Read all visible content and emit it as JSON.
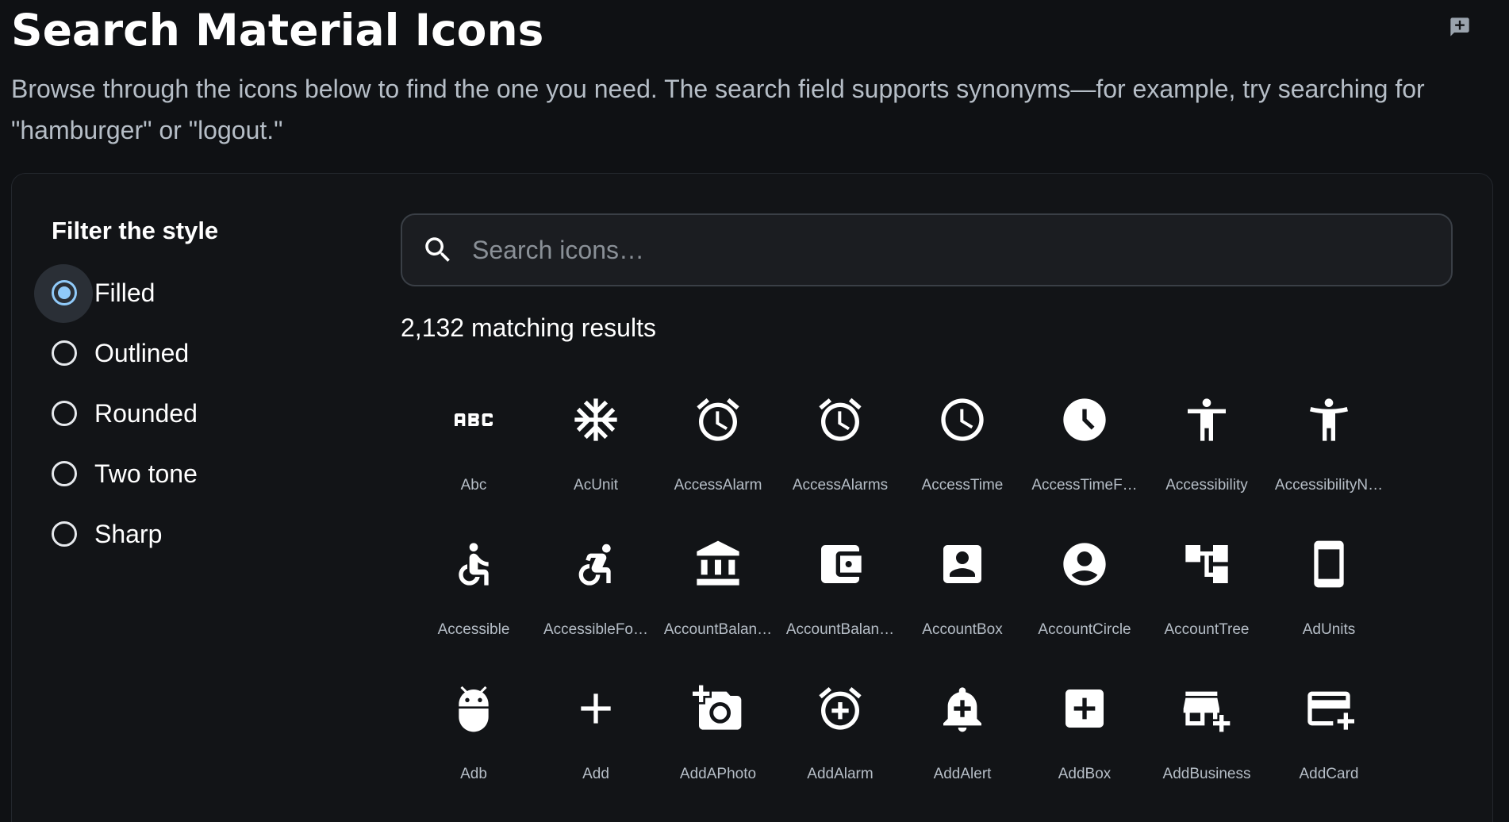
{
  "header": {
    "title": "Search Material Icons",
    "description": "Browse through the icons below to find the one you need. The search field supports synonyms—for example, try searching for \"hamburger\" or \"logout.\"",
    "feedback_icon": "add-comment-icon"
  },
  "filter": {
    "title": "Filter the style",
    "options": [
      {
        "label": "Filled",
        "selected": true
      },
      {
        "label": "Outlined",
        "selected": false
      },
      {
        "label": "Rounded",
        "selected": false
      },
      {
        "label": "Two tone",
        "selected": false
      },
      {
        "label": "Sharp",
        "selected": false
      }
    ]
  },
  "search": {
    "placeholder": "Search icons…",
    "value": ""
  },
  "results": {
    "count_label": "2,132 matching results"
  },
  "icons": [
    {
      "name": "Abc",
      "icon": "abc-icon"
    },
    {
      "name": "AcUnit",
      "icon": "ac-unit-icon"
    },
    {
      "name": "AccessAlarm",
      "icon": "access-alarm-icon"
    },
    {
      "name": "AccessAlarms",
      "icon": "access-alarms-icon"
    },
    {
      "name": "AccessTime",
      "icon": "access-time-icon"
    },
    {
      "name": "AccessTimeF…",
      "icon": "access-time-filled-icon"
    },
    {
      "name": "Accessibility",
      "icon": "accessibility-icon"
    },
    {
      "name": "AccessibilityN…",
      "icon": "accessibility-new-icon"
    },
    {
      "name": "Accessible",
      "icon": "accessible-icon"
    },
    {
      "name": "AccessibleFo…",
      "icon": "accessible-forward-icon"
    },
    {
      "name": "AccountBalan…",
      "icon": "account-balance-icon"
    },
    {
      "name": "AccountBalan…",
      "icon": "account-balance-wallet-icon"
    },
    {
      "name": "AccountBox",
      "icon": "account-box-icon"
    },
    {
      "name": "AccountCircle",
      "icon": "account-circle-icon"
    },
    {
      "name": "AccountTree",
      "icon": "account-tree-icon"
    },
    {
      "name": "AdUnits",
      "icon": "ad-units-icon"
    },
    {
      "name": "Adb",
      "icon": "adb-icon"
    },
    {
      "name": "Add",
      "icon": "add-icon"
    },
    {
      "name": "AddAPhoto",
      "icon": "add-a-photo-icon"
    },
    {
      "name": "AddAlarm",
      "icon": "add-alarm-icon"
    },
    {
      "name": "AddAlert",
      "icon": "add-alert-icon"
    },
    {
      "name": "AddBox",
      "icon": "add-box-icon"
    },
    {
      "name": "AddBusiness",
      "icon": "add-business-icon"
    },
    {
      "name": "AddCard",
      "icon": "add-card-icon"
    }
  ],
  "colors": {
    "background": "#0f1114",
    "panel": "#121417",
    "accent": "#90caf9",
    "text_secondary": "#b6bec7"
  }
}
